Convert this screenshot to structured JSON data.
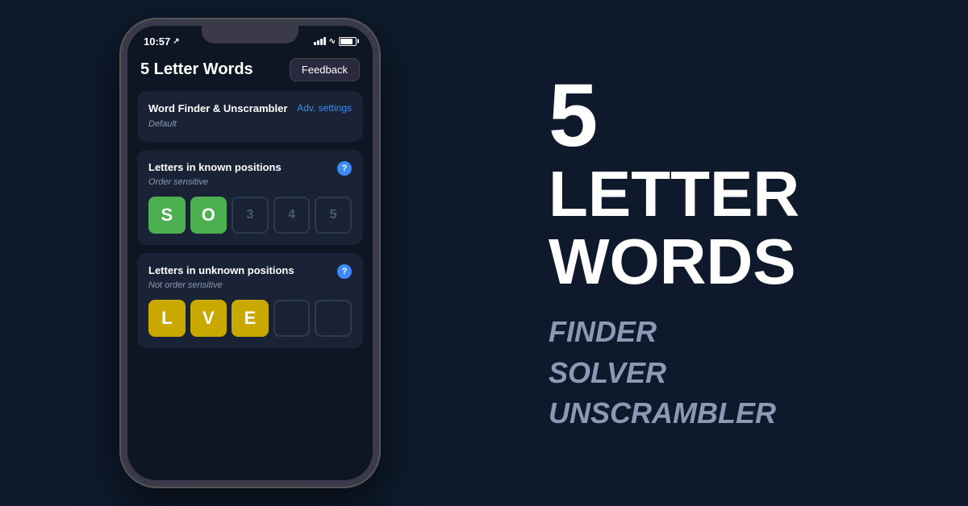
{
  "background_color": "#0e1a2b",
  "phone": {
    "status_bar": {
      "time": "10:57",
      "location_icon": "▲"
    },
    "header": {
      "title": "5 Letter Words",
      "feedback_button": "Feedback"
    },
    "sections": [
      {
        "id": "word-finder",
        "title": "Word Finder & Unscrambler",
        "subtitle": "Default",
        "link": "Adv. settings"
      },
      {
        "id": "known-positions",
        "title": "Letters in known positions",
        "subtitle": "Order sensitive",
        "has_help": true,
        "letters": [
          {
            "char": "S",
            "type": "green"
          },
          {
            "char": "O",
            "type": "green"
          },
          {
            "char": "3",
            "type": "empty"
          },
          {
            "char": "4",
            "type": "empty"
          },
          {
            "char": "5",
            "type": "empty"
          }
        ]
      },
      {
        "id": "unknown-positions",
        "title": "Letters in unknown positions",
        "subtitle": "Not order sensitive",
        "has_help": true,
        "letters": [
          {
            "char": "L",
            "type": "yellow"
          },
          {
            "char": "V",
            "type": "yellow"
          },
          {
            "char": "E",
            "type": "yellow"
          },
          {
            "char": "",
            "type": "empty"
          },
          {
            "char": "",
            "type": "empty"
          }
        ]
      }
    ]
  },
  "hero": {
    "number": "5",
    "word1": "LETTER",
    "word2": "WORDS",
    "subtitle_lines": [
      "FINDER",
      "SOLVER",
      "UNSCRAMBLER"
    ]
  }
}
